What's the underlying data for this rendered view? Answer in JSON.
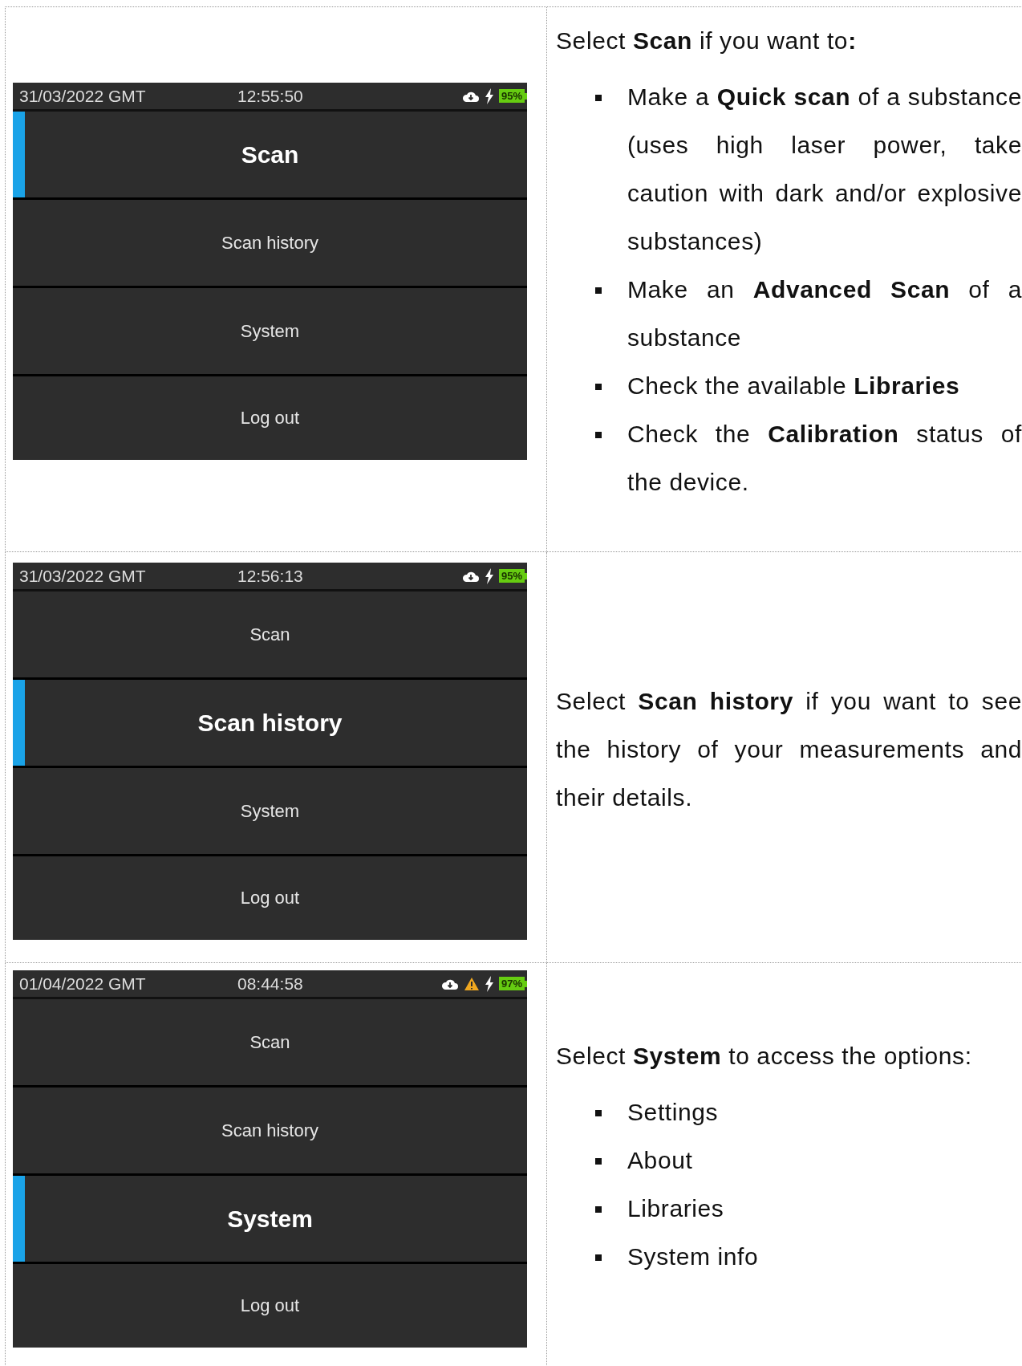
{
  "rows": [
    {
      "device": {
        "date": "31/03/2022 GMT",
        "time": "12:55:50",
        "warning": false,
        "battery": "95%",
        "items": [
          {
            "label": "Scan",
            "selected": true
          },
          {
            "label": "Scan history",
            "selected": false
          },
          {
            "label": "System",
            "selected": false
          },
          {
            "label": "Log out",
            "selected": false
          }
        ]
      },
      "description": {
        "blocks": [
          {
            "kind": "paragraph",
            "text": "Select **Scan** if you want to**:**"
          },
          {
            "kind": "bullets",
            "items": [
              "Make a **Quick scan** of a substance (uses high laser power, take caution with dark and/or explosive substances)",
              "Make an **Advanced Scan** of a substance",
              "Check the available **Libraries**",
              "Check the **Calibration** status of the device."
            ]
          }
        ]
      }
    },
    {
      "device": {
        "date": "31/03/2022 GMT",
        "time": "12:56:13",
        "warning": false,
        "battery": "95%",
        "items": [
          {
            "label": "Scan",
            "selected": false
          },
          {
            "label": "Scan history",
            "selected": true
          },
          {
            "label": "System",
            "selected": false
          },
          {
            "label": "Log out",
            "selected": false
          }
        ]
      },
      "description": {
        "blocks": [
          {
            "kind": "paragraph",
            "text": "Select **Scan history** if you want to see the history of your measurements and their details."
          }
        ]
      }
    },
    {
      "device": {
        "date": "01/04/2022 GMT",
        "time": "08:44:58",
        "warning": true,
        "battery": "97%",
        "items": [
          {
            "label": "Scan",
            "selected": false
          },
          {
            "label": "Scan history",
            "selected": false
          },
          {
            "label": "System",
            "selected": true
          },
          {
            "label": "Log out",
            "selected": false
          }
        ]
      },
      "description": {
        "blocks": [
          {
            "kind": "paragraph",
            "text": "Select **System** to access the options:"
          },
          {
            "kind": "bullets",
            "items": [
              "Settings",
              "About",
              "Libraries",
              "System info"
            ]
          }
        ]
      }
    }
  ]
}
